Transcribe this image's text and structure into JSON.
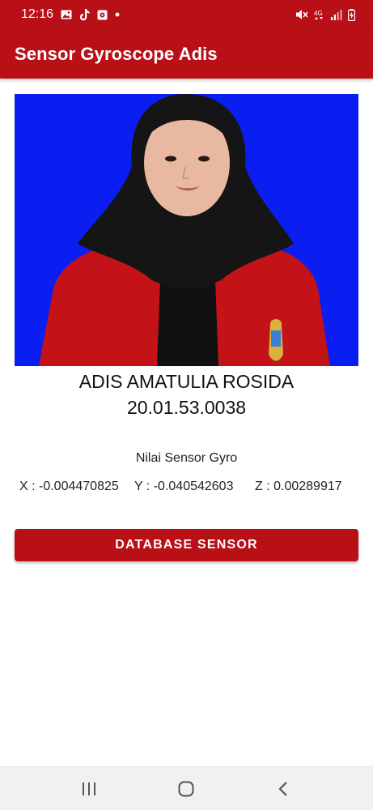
{
  "status_bar": {
    "time": "12:16",
    "left_icons": [
      "gallery-icon",
      "tiktok-icon",
      "notification-app-icon",
      "dot-icon"
    ],
    "right_icons": [
      "mute-icon",
      "network-4g-icon",
      "signal-icon",
      "battery-charging-icon"
    ],
    "network_label": "4G"
  },
  "app_bar": {
    "title": "Sensor Gyroscope Adis"
  },
  "colors": {
    "primary": "#b90f16",
    "photo_background": "#0a1ef2",
    "nav_background": "#f1f1f1"
  },
  "profile": {
    "name": "ADIS AMATULIA ROSIDA",
    "nim": "20.01.53.0038"
  },
  "sensor": {
    "title": "Nilai Sensor Gyro",
    "x": "X : -0.004470825",
    "y": "Y : -0.040542603",
    "z": "Z : 0.00289917"
  },
  "button": {
    "label": "DATABASE SENSOR"
  },
  "nav": {
    "icons": [
      "recent-apps-icon",
      "home-icon",
      "back-icon"
    ]
  }
}
